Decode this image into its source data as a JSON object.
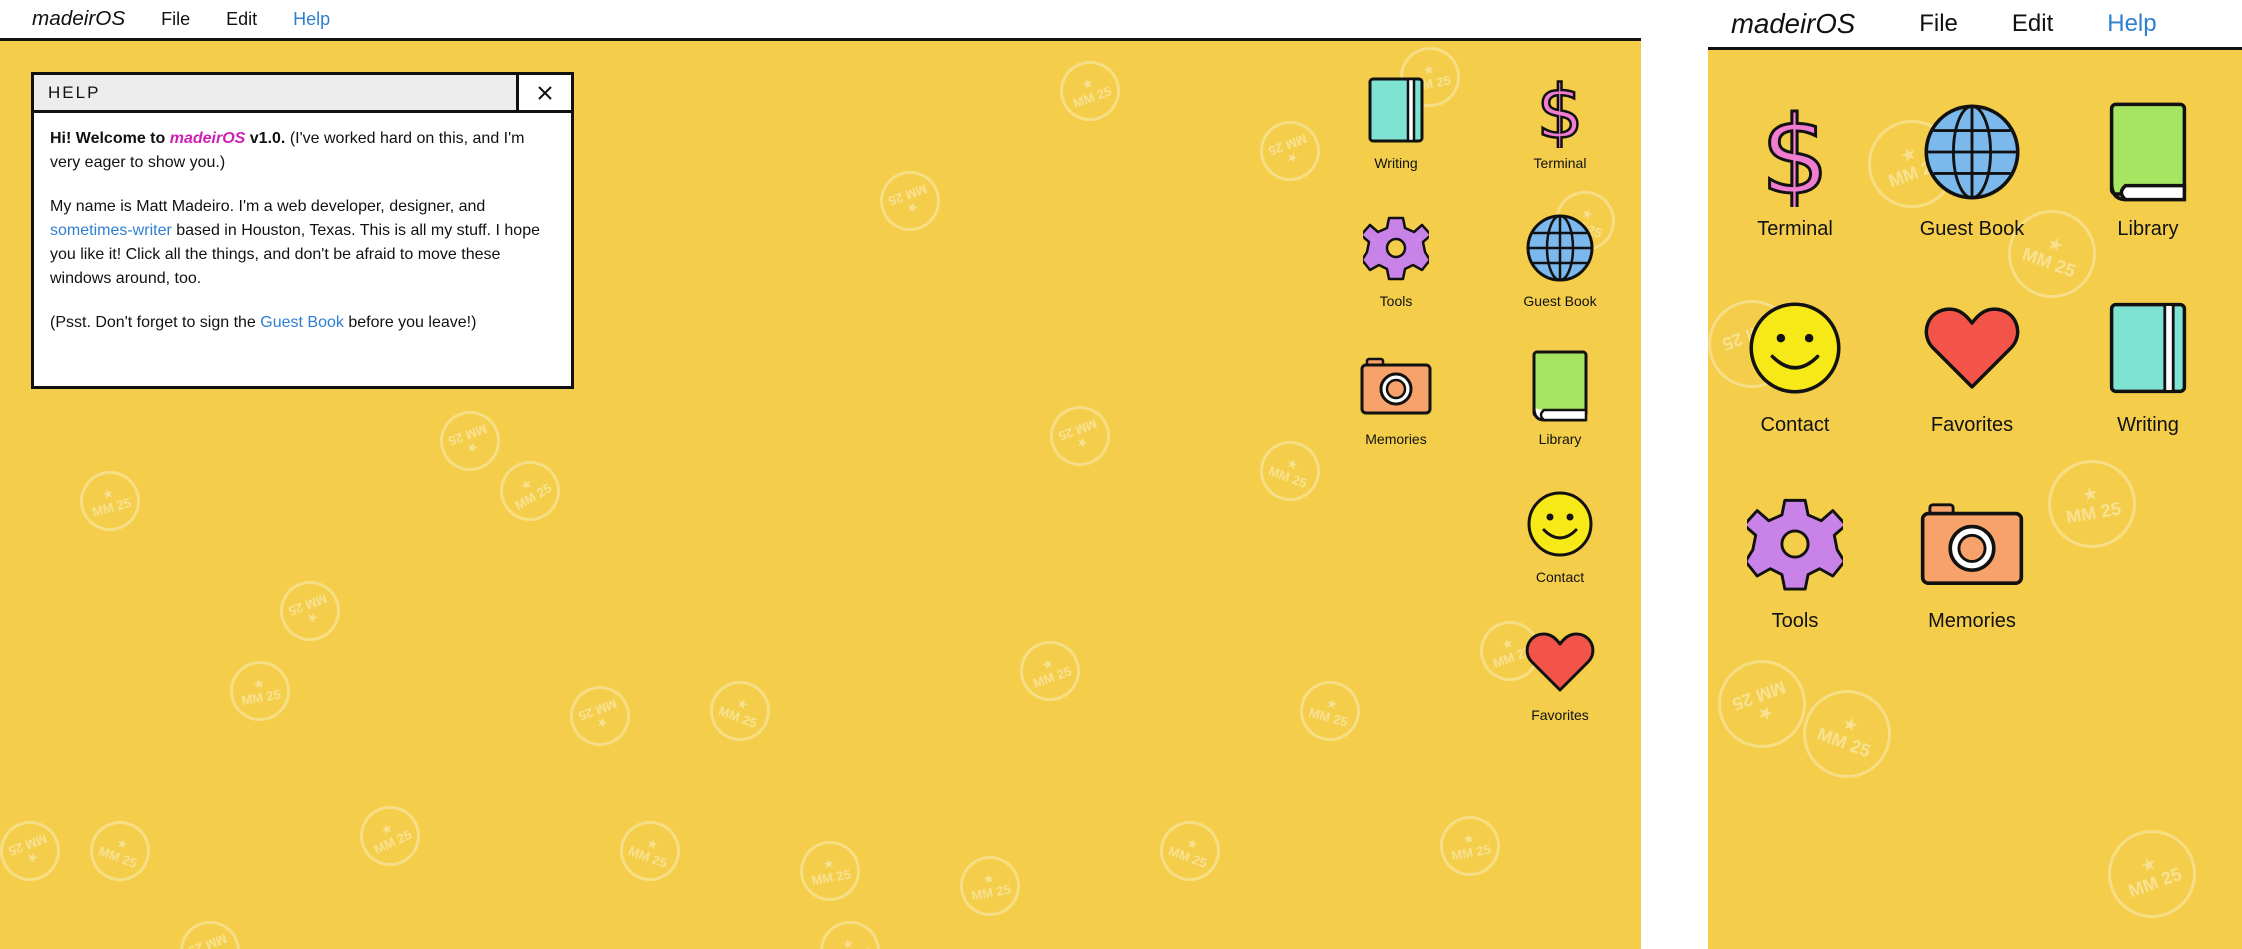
{
  "desktop": {
    "menubar": {
      "brand": "madeirOS",
      "items": [
        "File",
        "Edit",
        "Help"
      ],
      "active": "Help"
    },
    "help_window": {
      "title": "HELP",
      "p1_bold_start": "Hi! Welcome to",
      "p1_brand": "madeirOS",
      "p1_bold_end": "v1.0.",
      "p1_rest": "(I've worked hard on this, and I'm very eager to show you.)",
      "p2_start": "My name is Matt Madeiro. I'm a web developer, designer, and",
      "p2_link": "sometimes-writer",
      "p2_end": "based in Houston, Texas. This is all my stuff. I hope you like it! Click all the things, and don't be afraid to move these windows around, too.",
      "p3_start": "(Psst. Don't forget to sign the",
      "p3_link": "Guest Book",
      "p3_end": "before you leave!)"
    },
    "icons": {
      "writing": "Writing",
      "terminal": "Terminal",
      "tools": "Tools",
      "guestbook": "Guest Book",
      "memories": "Memories",
      "library": "Library",
      "contact": "Contact",
      "favorites": "Favorites"
    }
  },
  "mobile": {
    "menubar": {
      "brand": "madeirOS",
      "items": [
        "File",
        "Edit",
        "Help"
      ],
      "active": "Help"
    },
    "icons": {
      "terminal": "Terminal",
      "guestbook": "Guest Book",
      "library": "Library",
      "contact": "Contact",
      "favorites": "Favorites",
      "writing": "Writing",
      "tools": "Tools",
      "memories": "Memories"
    }
  },
  "wallpaper": {
    "stamp_text": "MM 25",
    "color": "#f4ce4b"
  },
  "colors": {
    "link": "#2f7fd1",
    "brand_pink": "#d11fb4",
    "wallpaper": "#f4ce4b"
  }
}
